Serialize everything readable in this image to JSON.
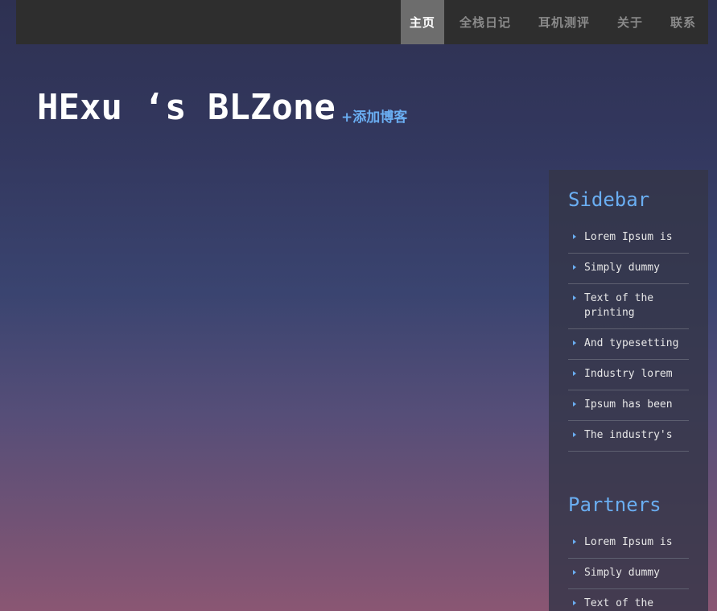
{
  "nav": {
    "items": [
      {
        "label": "主页",
        "active": true
      },
      {
        "label": "全栈日记",
        "active": false
      },
      {
        "label": "耳机测评",
        "active": false
      },
      {
        "label": "关于",
        "active": false
      },
      {
        "label": "联系",
        "active": false
      }
    ]
  },
  "header": {
    "title": "HExu ‘s BLZone",
    "add_blog_link": "+添加博客"
  },
  "sidebar": {
    "title": "Sidebar",
    "items": [
      {
        "label": "Lorem Ipsum is"
      },
      {
        "label": "Simply dummy"
      },
      {
        "label": "Text of the printing"
      },
      {
        "label": "And typesetting"
      },
      {
        "label": "Industry lorem"
      },
      {
        "label": "Ipsum has been"
      },
      {
        "label": "The industry's"
      }
    ]
  },
  "partners": {
    "title": "Partners",
    "items": [
      {
        "label": "Lorem Ipsum is"
      },
      {
        "label": "Simply dummy"
      },
      {
        "label": "Text of the"
      }
    ]
  },
  "colors": {
    "accent": "#6aaef2",
    "navbar_bg": "#2e2e2e",
    "nav_active_bg": "#6d6d6d",
    "nav_text": "#8a8a8a"
  }
}
